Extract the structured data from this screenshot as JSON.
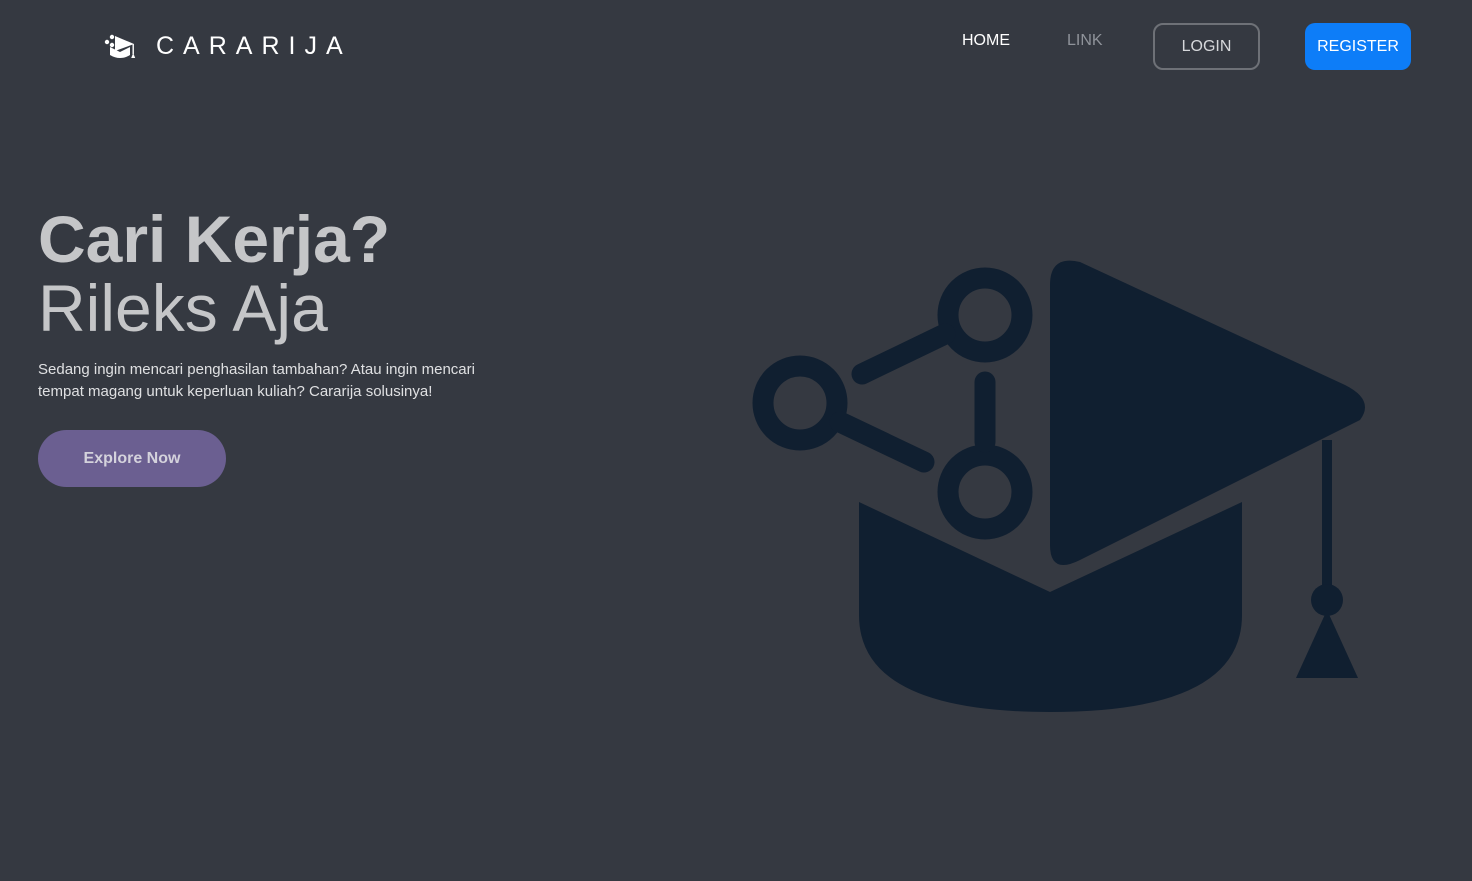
{
  "header": {
    "brand_name": "CARARIJA",
    "brand_icon": "graduation-cap-icon",
    "nav": {
      "home_label": "HOME",
      "link_label": "LINK"
    },
    "login_label": "LOGIN",
    "register_label": "REGISTER"
  },
  "hero": {
    "title": "Cari Kerja?",
    "subtitle": "Rileks Aja",
    "description": "Sedang ingin mencari penghasilan tambahan? Atau ingin mencari tempat magang untuk keperluan kuliah? Cararija solusinya!",
    "cta_label": "Explore Now",
    "illustration_icon": "graduation-cap-network-icon"
  },
  "colors": {
    "background": "#353941",
    "accent_primary": "#0d7df8",
    "cta": "#6b5f91",
    "illustration": "#101f30",
    "heading_text": "#c5c6c8"
  }
}
